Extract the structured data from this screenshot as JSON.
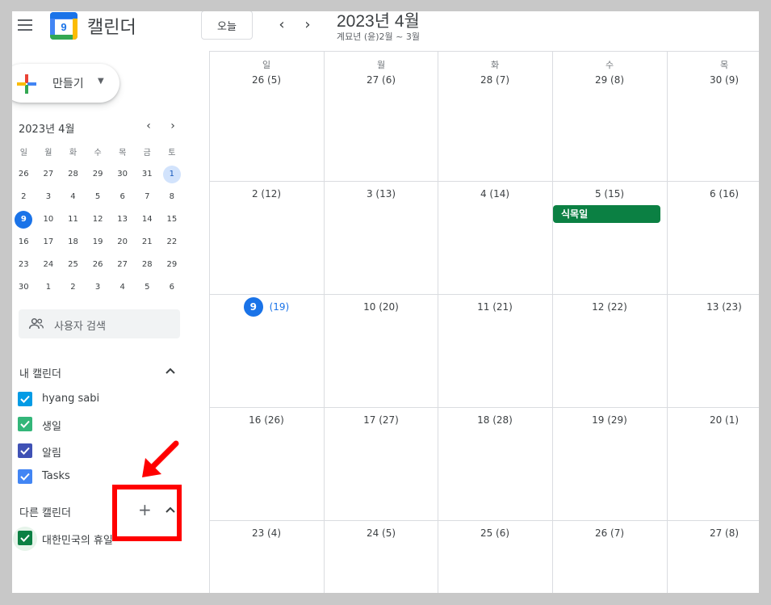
{
  "header": {
    "app_title": "캘린더",
    "logo_day": "9",
    "today_label": "오늘",
    "prev_icon": "chevron-left-icon",
    "next_icon": "chevron-right-icon",
    "month_title": "2023년 4월",
    "lunar_subtitle": "계묘년 (윤)2월 ~ 3월"
  },
  "sidebar": {
    "create_label": "만들기",
    "mini_calendar": {
      "title": "2023년 4월",
      "weekday_headers": [
        "일",
        "월",
        "화",
        "수",
        "목",
        "금",
        "토"
      ],
      "weeks": [
        [
          "26",
          "27",
          "28",
          "29",
          "30",
          "31",
          "1"
        ],
        [
          "2",
          "3",
          "4",
          "5",
          "6",
          "7",
          "8"
        ],
        [
          "9",
          "10",
          "11",
          "12",
          "13",
          "14",
          "15"
        ],
        [
          "16",
          "17",
          "18",
          "19",
          "20",
          "21",
          "22"
        ],
        [
          "23",
          "24",
          "25",
          "26",
          "27",
          "28",
          "29"
        ],
        [
          "30",
          "1",
          "2",
          "3",
          "4",
          "5",
          "6"
        ]
      ]
    },
    "people_search_placeholder": "사용자 검색",
    "my_calendars_title": "내 캘린더",
    "my_calendars": [
      {
        "label": "hyang sabi",
        "color": "#039be5"
      },
      {
        "label": "생일",
        "color": "#33b679"
      },
      {
        "label": "알림",
        "color": "#3f51b5"
      },
      {
        "label": "Tasks",
        "color": "#4285f4"
      }
    ],
    "other_calendars_title": "다른 캘린더",
    "other_calendars": [
      {
        "label": "대한민국의 휴일",
        "color": "#0b8043"
      }
    ]
  },
  "month_grid": {
    "weekday_headers": [
      "일",
      "월",
      "화",
      "수",
      "목"
    ],
    "weeks": [
      [
        {
          "day": "26",
          "lunar": "(5)"
        },
        {
          "day": "27",
          "lunar": "(6)"
        },
        {
          "day": "28",
          "lunar": "(7)"
        },
        {
          "day": "29",
          "lunar": "(8)"
        },
        {
          "day": "30",
          "lunar": "(9)"
        }
      ],
      [
        {
          "day": "2",
          "lunar": "(12)"
        },
        {
          "day": "3",
          "lunar": "(13)"
        },
        {
          "day": "4",
          "lunar": "(14)"
        },
        {
          "day": "5",
          "lunar": "(15)"
        },
        {
          "day": "6",
          "lunar": "(16)"
        }
      ],
      [
        {
          "day": "9",
          "lunar": "(19)"
        },
        {
          "day": "10",
          "lunar": "(20)"
        },
        {
          "day": "11",
          "lunar": "(21)"
        },
        {
          "day": "12",
          "lunar": "(22)"
        },
        {
          "day": "13",
          "lunar": "(23)"
        }
      ],
      [
        {
          "day": "16",
          "lunar": "(26)"
        },
        {
          "day": "17",
          "lunar": "(27)"
        },
        {
          "day": "18",
          "lunar": "(28)"
        },
        {
          "day": "19",
          "lunar": "(29)"
        },
        {
          "day": "20",
          "lunar": "(1)"
        }
      ],
      [
        {
          "day": "23",
          "lunar": "(4)"
        },
        {
          "day": "24",
          "lunar": "(5)"
        },
        {
          "day": "25",
          "lunar": "(6)"
        },
        {
          "day": "26",
          "lunar": "(7)"
        },
        {
          "day": "27",
          "lunar": "(8)"
        }
      ]
    ],
    "event": {
      "label": "식목일",
      "color": "#0b8043"
    }
  },
  "annotation": {
    "box_color": "#ff0000"
  }
}
